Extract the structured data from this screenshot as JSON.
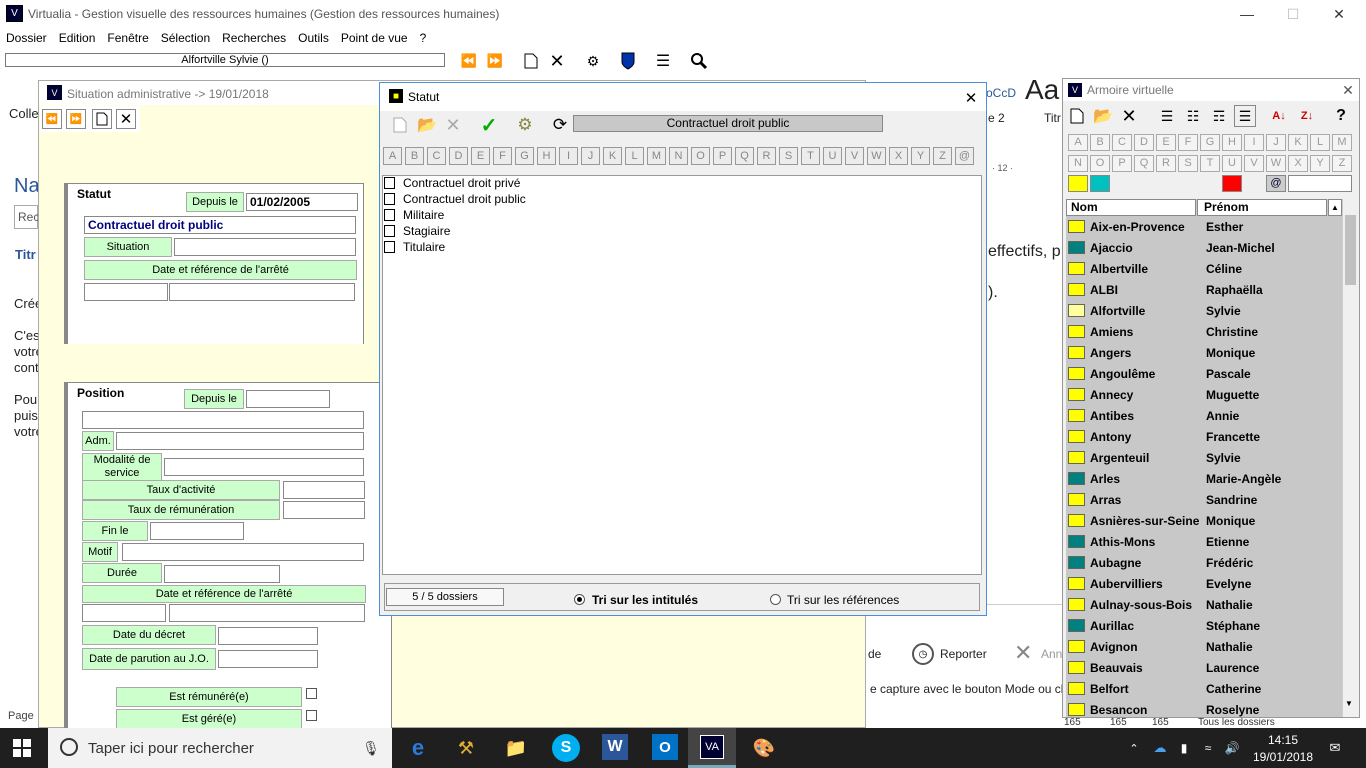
{
  "app": {
    "title": "Virtualia - Gestion visuelle des ressources humaines  (Gestion des ressources humaines)"
  },
  "menu": [
    "Dossier",
    "Edition",
    "Fenêtre",
    "Sélection",
    "Recherches",
    "Outils",
    "Point de vue",
    "?"
  ],
  "toolbar": {
    "person_combo": "Alfortville  Sylvie   ()"
  },
  "background_word": {
    "line1": "Colle",
    "line2": "Na",
    "line3": "Rech",
    "line4": "Titr",
    "line5": "Crée",
    "line6": "C'est",
    "line7": "votre",
    "line8": "cont",
    "line9": "Pour",
    "line10": "puis",
    "line11": "votre",
    "pagelabel": "Page",
    "aa": "Aa",
    "occ": "oCcD",
    "two": "e 2",
    "titr2": "Titr",
    "ruler": "· 12 ·",
    "effectifs": "effectifs, p",
    "paren": ").",
    "reporter": "Reporter",
    "de": "de",
    "ann": "Ann",
    "capture": "e capture avec le bouton Mode ou cli"
  },
  "situation": {
    "title": "Situation administrative -> 19/01/2018",
    "statut_header": "Statut",
    "depuis_label": "Depuis le",
    "depuis_value": "01/02/2005",
    "statut_value": "Contractuel droit public",
    "situation_label": "Situation",
    "date_ref_label": "Date et référence de l'arrêté",
    "position_header": "Position",
    "position_depuis": "Depuis le",
    "adm": "Adm.",
    "modalite": "Modalité de service",
    "taux_activite": "Taux d'activité",
    "taux_remuneration": "Taux de rémunération",
    "fin_le": "Fin le",
    "motif": "Motif",
    "duree": "Durée",
    "date_ref2": "Date et référence de l'arrêté",
    "date_decret": "Date du décret",
    "date_parution": "Date de parution au J.O.",
    "est_remunere": "Est rémunéré(e)",
    "est_gere": "Est géré(e)"
  },
  "statut_dialog": {
    "title": "Statut",
    "selected": "Contractuel droit public",
    "letters": [
      "A",
      "B",
      "C",
      "D",
      "E",
      "F",
      "G",
      "H",
      "I",
      "J",
      "K",
      "L",
      "M",
      "N",
      "O",
      "P",
      "Q",
      "R",
      "S",
      "T",
      "U",
      "V",
      "W",
      "X",
      "Y",
      "Z",
      "@"
    ],
    "items": [
      "Contractuel droit privé",
      "Contractuel droit public",
      "Militaire",
      "Stagiaire",
      "Titulaire"
    ],
    "count": "5 /  5 dossiers",
    "sort_titles": "Tri sur les intitulés",
    "sort_refs": "Tri sur les références"
  },
  "armoire": {
    "title": "Armoire virtuelle",
    "letters1": [
      "A",
      "B",
      "C",
      "D",
      "E",
      "F",
      "G",
      "H",
      "I",
      "J",
      "K",
      "L",
      "M"
    ],
    "letters2": [
      "N",
      "O",
      "P",
      "Q",
      "R",
      "S",
      "T",
      "U",
      "V",
      "W",
      "X",
      "Y",
      "Z"
    ],
    "col_nom": "Nom",
    "col_prenom": "Prénom",
    "at": "@",
    "rows": [
      {
        "nom": "Aix-en-Provence",
        "prenom": "Esther",
        "c": "#ffff00"
      },
      {
        "nom": "Ajaccio",
        "prenom": "Jean-Michel",
        "c": "#008080"
      },
      {
        "nom": "Albertville",
        "prenom": "Céline",
        "c": "#ffff00"
      },
      {
        "nom": "ALBI",
        "prenom": "Raphaëlla",
        "c": "#ffff00"
      },
      {
        "nom": "Alfortville",
        "prenom": "Sylvie",
        "c": "#ffffa0"
      },
      {
        "nom": "Amiens",
        "prenom": "Christine",
        "c": "#ffff00"
      },
      {
        "nom": "Angers",
        "prenom": "Monique",
        "c": "#ffff00"
      },
      {
        "nom": "Angoulême",
        "prenom": "Pascale",
        "c": "#ffff00"
      },
      {
        "nom": "Annecy",
        "prenom": "Muguette",
        "c": "#ffff00"
      },
      {
        "nom": "Antibes",
        "prenom": "Annie",
        "c": "#ffff00"
      },
      {
        "nom": "Antony",
        "prenom": "Francette",
        "c": "#ffff00"
      },
      {
        "nom": "Argenteuil",
        "prenom": "Sylvie",
        "c": "#ffff00"
      },
      {
        "nom": "Arles",
        "prenom": "Marie-Angèle",
        "c": "#008080"
      },
      {
        "nom": "Arras",
        "prenom": "Sandrine",
        "c": "#ffff00"
      },
      {
        "nom": "Asnières-sur-Seine",
        "prenom": "Monique",
        "c": "#ffff00"
      },
      {
        "nom": "Athis-Mons",
        "prenom": "Etienne",
        "c": "#008080"
      },
      {
        "nom": "Aubagne",
        "prenom": "Frédéric",
        "c": "#008080"
      },
      {
        "nom": "Aubervilliers",
        "prenom": "Evelyne",
        "c": "#ffff00"
      },
      {
        "nom": "Aulnay-sous-Bois",
        "prenom": "Nathalie",
        "c": "#ffff00"
      },
      {
        "nom": "Aurillac",
        "prenom": "Stéphane",
        "c": "#008080"
      },
      {
        "nom": "Avignon",
        "prenom": "Nathalie",
        "c": "#ffff00"
      },
      {
        "nom": "Beauvais",
        "prenom": "Laurence",
        "c": "#ffff00"
      },
      {
        "nom": "Belfort",
        "prenom": "Catherine",
        "c": "#ffff00"
      },
      {
        "nom": "Besancon",
        "prenom": "Roselyne",
        "c": "#ffff00"
      }
    ],
    "status": [
      "165",
      "165",
      "165",
      "Tous les dossiers"
    ]
  },
  "taskbar": {
    "search": "Taper ici pour rechercher",
    "time": "14:15",
    "date": "19/01/2018"
  }
}
